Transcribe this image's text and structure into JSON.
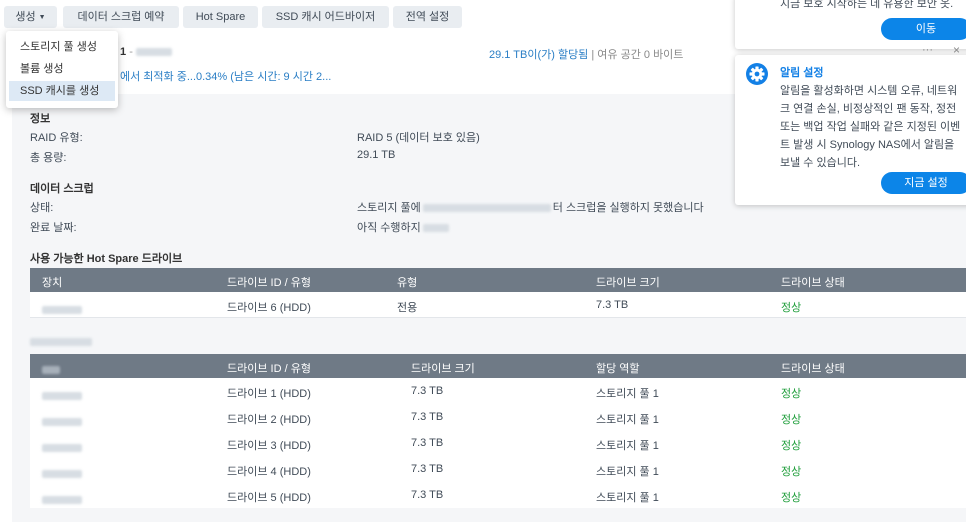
{
  "toolbar": {
    "create_label": "생성",
    "scrub_schedule_label": "데이터 스크럽 예약",
    "hot_spare_label": "Hot Spare",
    "ssd_advisor_label": "SSD 캐시 어드바이저",
    "global_settings_label": "전역 설정"
  },
  "create_menu": {
    "items": [
      "스토리지 풀 생성",
      "볼륨 생성",
      "SSD 캐시를 생성"
    ]
  },
  "pool_summary": {
    "name_suffix": "1",
    "separator": "-",
    "progress": "에서 최적화 중...0.34% (남은 시간: 9 시간 2...",
    "allocated": "29.1 TB이(가) 할당됨",
    "divider": "|",
    "free": "여유 공간 0 바이트"
  },
  "info": {
    "title": "정보",
    "raid_label": "RAID 유형:",
    "raid_value": "RAID 5 (데이터 보호 있음)",
    "capacity_label": "총 용량:",
    "capacity_value": "29.1 TB"
  },
  "scrub": {
    "title": "데이터 스크럽",
    "status_label": "상태:",
    "status_prefix": "스토리지 풀에",
    "status_suffix": "터 스크럽을 실행하지 못했습니다",
    "done_label": "완료 날짜:",
    "done_prefix": "아직 수행하지"
  },
  "hot_spare": {
    "title": "사용 가능한 Hot Spare 드라이브",
    "headers": [
      "장치",
      "드라이브 ID / 유형",
      "유형",
      "드라이브 크기",
      "드라이브 상태"
    ],
    "row": {
      "drive": "드라이브 6 (HDD)",
      "type": "전용",
      "size": "7.3 TB",
      "status": "정상"
    }
  },
  "drive_info": {
    "headers": [
      "장치",
      "드라이브 ID / 유형",
      "드라이브 크기",
      "할당 역할",
      "드라이브 상태"
    ],
    "rows": [
      {
        "drive": "드라이브 1 (HDD)",
        "size": "7.3 TB",
        "role": "스토리지 풀 1",
        "status": "정상"
      },
      {
        "drive": "드라이브 2 (HDD)",
        "size": "7.3 TB",
        "role": "스토리지 풀 1",
        "status": "정상"
      },
      {
        "drive": "드라이브 3 (HDD)",
        "size": "7.3 TB",
        "role": "스토리지 풀 1",
        "status": "정상"
      },
      {
        "drive": "드라이브 4 (HDD)",
        "size": "7.3 TB",
        "role": "스토리지 풀 1",
        "status": "정상"
      },
      {
        "drive": "드라이브 5 (HDD)",
        "size": "7.3 TB",
        "role": "스토리지 풀 1",
        "status": "정상"
      }
    ]
  },
  "notice_top": {
    "text": "지금 보호 시작하는 데 유용한 보안 옷.",
    "button": "이동"
  },
  "notice_alert": {
    "title": "알림 설정",
    "body": "알림을 활성화하면 시스템 오류, 네트워크 연결 손실, 비정상적인 팬 동작, 정전 또는 백업 작업 실패와 같은 지정된 이벤트 발생 시 Synology NAS에서 알림을 보낼 수 있습니다.",
    "button": "지금 설정",
    "more": "···",
    "close": "×"
  },
  "colors": {
    "accent": "#0c85e8",
    "table_header": "#6f7a86",
    "healthy": "#1f9e3b",
    "link": "#2a7ec5"
  }
}
